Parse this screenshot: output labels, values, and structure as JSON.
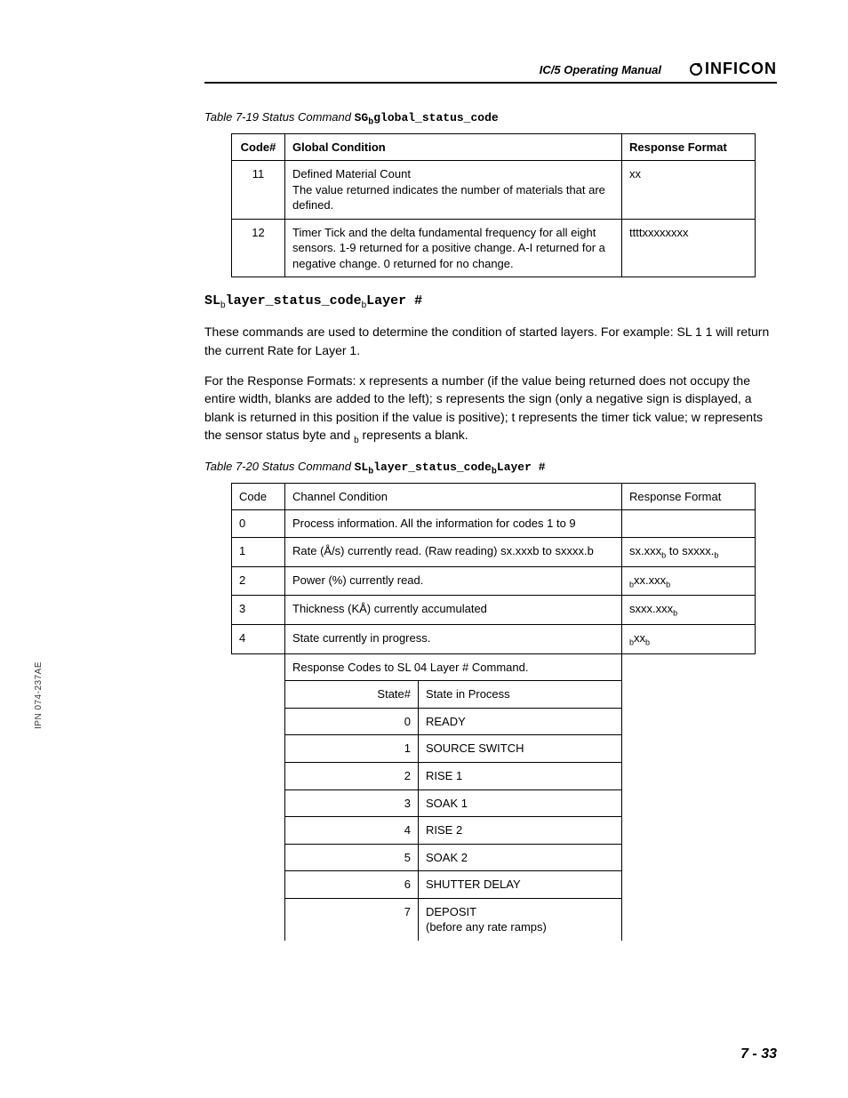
{
  "header": {
    "title": "IC/5 Operating Manual",
    "brand": "INFICON"
  },
  "sidelabel": "IPN 074-237AE",
  "table19": {
    "caption_prefix": "Table 7-19  Status Command ",
    "caption_code_a": "SG",
    "caption_sub": "b",
    "caption_code_b": "global_status_code",
    "headers": {
      "code": "Code#",
      "cond": "Global Condition",
      "resp": "Response Format"
    },
    "rows": [
      {
        "code": "11",
        "cond": "Defined Material Count\nThe value returned indicates the number of materials that are defined.",
        "resp": "xx"
      },
      {
        "code": "12",
        "cond": "Timer Tick and the delta fundamental frequency for all eight sensors. 1-9 returned for a positive change. A-I returned for a negative change. 0 returned for no change.",
        "resp": "ttttxxxxxxxx"
      }
    ]
  },
  "section": {
    "code_a": "SL",
    "sub1": "b",
    "code_b": "layer_status_code",
    "sub2": "b",
    "code_c": "Layer #"
  },
  "para1": "These commands are used to determine the condition of started layers. For example: SL 1 1 will return the current Rate for Layer 1.",
  "para2_a": "For the Response Formats: x represents a number (if the value being returned does not occupy the entire width, blanks are added to the left); s represents the sign (only a negative sign is displayed, a blank is returned in this position if the value is positive); t represents the timer tick value; w represents the sensor status byte and ",
  "para2_sub": "b",
  "para2_b": " represents a blank.",
  "table20": {
    "caption_prefix": "Table 7-20  Status Command ",
    "caption_code_a": "SL",
    "caption_sub1": "b",
    "caption_code_b": "layer_status_code",
    "caption_sub2": "b",
    "caption_code_c": "Layer #",
    "headers": {
      "code": "Code",
      "cond": "Channel Condition",
      "resp": "Response Format"
    },
    "rows": [
      {
        "code": "0",
        "cond": "Process information. All the information for codes 1 to 9",
        "resp": ""
      },
      {
        "code": "1",
        "cond": "Rate (Å/s) currently read. (Raw reading) sx.xxxb to sxxxx.b",
        "resp_a": "sx.xxx",
        "resp_sub1": "b",
        "resp_mid": " to sxxxx.",
        "resp_sub2": "b"
      },
      {
        "code": "2",
        "cond": "Power (%) currently read.",
        "resp_sub_a": "b",
        "resp_mid": "xx.xxx",
        "resp_sub_b": "b"
      },
      {
        "code": "3",
        "cond": "Thickness (KÅ) currently accumulated",
        "resp_a": "sxxx.xxx",
        "resp_sub": "b"
      },
      {
        "code": "4",
        "cond": "State currently in progress.",
        "resp_sub_a": "b",
        "resp_mid": "xx",
        "resp_sub_b": "b"
      }
    ],
    "inner_header": "Response Codes to SL 04 Layer # Command.",
    "inner_cols": {
      "state": "State#",
      "proc": "State in Process"
    },
    "inner_rows": [
      {
        "n": "0",
        "p": "READY"
      },
      {
        "n": "1",
        "p": "SOURCE SWITCH"
      },
      {
        "n": "2",
        "p": "RISE 1"
      },
      {
        "n": "3",
        "p": "SOAK 1"
      },
      {
        "n": "4",
        "p": "RISE 2"
      },
      {
        "n": "5",
        "p": "SOAK 2"
      },
      {
        "n": "6",
        "p": "SHUTTER DELAY"
      },
      {
        "n": "7",
        "p": "DEPOSIT\n(before any rate ramps)"
      }
    ]
  },
  "footer": "7 - 33"
}
